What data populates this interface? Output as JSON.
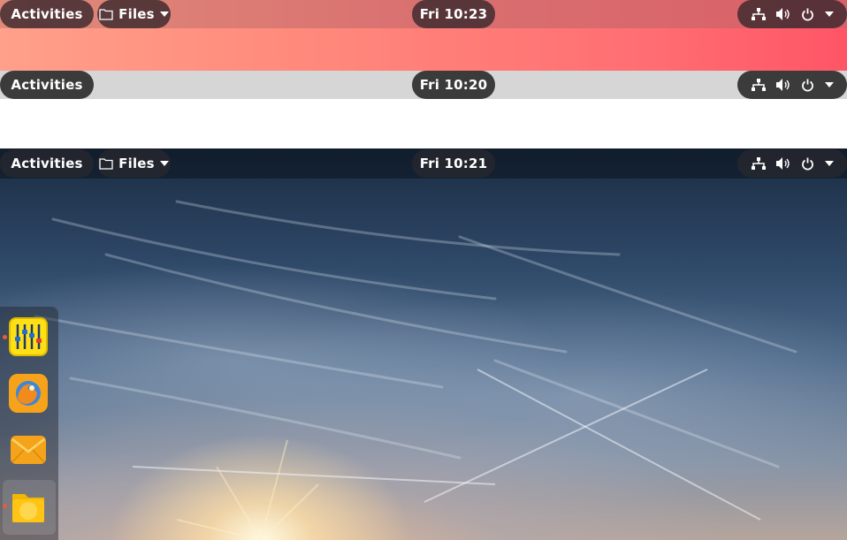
{
  "panels": [
    {
      "activities": "Activities",
      "app_menu": "Files",
      "clock": "Fri 10:23",
      "theme": "pink-gradient"
    },
    {
      "activities": "Activities",
      "clock": "Fri 10:20",
      "theme": "light-grey"
    },
    {
      "activities": "Activities",
      "app_menu": "Files",
      "clock": "Fri 10:21",
      "theme": "sky-wallpaper"
    }
  ],
  "tray_icons": [
    "network-icon",
    "volume-icon",
    "power-icon",
    "menu-arrow-icon"
  ],
  "dock": {
    "items": [
      {
        "name": "equalizer-app",
        "icon": "sliders-icon",
        "running": true
      },
      {
        "name": "firefox",
        "icon": "firefox-icon",
        "running": false
      },
      {
        "name": "mail",
        "icon": "envelope-icon",
        "running": false
      },
      {
        "name": "files",
        "icon": "folder-icon",
        "running": true,
        "focused": true
      }
    ]
  },
  "colors": {
    "panel1_gradient_start": "#ffa08a",
    "panel1_gradient_end": "#ff5566",
    "panel2_bar": "#d6d6d6",
    "pill_dark": "#3b3b3b",
    "running_indicator": "#e45e3d",
    "icon_yellow": "#ffd500",
    "icon_orange": "#f7a21b"
  }
}
